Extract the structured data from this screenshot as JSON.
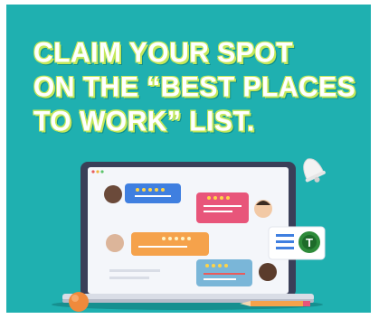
{
  "headline": {
    "line1": "CLAIM YOUR SPOT",
    "line2": "ON THE “BEST PLACES",
    "line3": "TO WORK” LIST."
  },
  "badge": {
    "letter": "T"
  },
  "colors": {
    "background": "#1fb0b0",
    "headline_text": "#ffffff",
    "headline_outline": "#c4e85a",
    "bubble_blue": "#3f7fe0",
    "bubble_pink": "#e8557a",
    "bubble_orange": "#f5a24b",
    "bubble_lightblue": "#7ab6d8",
    "badge_green": "#2e8b3a"
  },
  "icons": [
    "laptop-icon",
    "bell-icon",
    "star-rating-icon",
    "avatar-icon",
    "verified-badge-icon",
    "pencil-icon",
    "ball-icon"
  ]
}
